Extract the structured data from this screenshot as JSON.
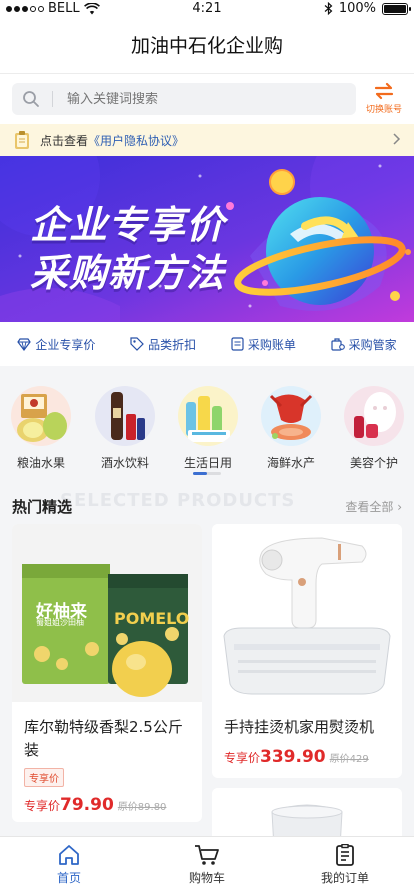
{
  "status_bar": {
    "carrier": "BELL",
    "time": "4:21",
    "battery": "100%",
    "battery_level": 1.0
  },
  "header": {
    "title": "加油中石化企业购"
  },
  "search": {
    "placeholder": "输入关键词搜索",
    "switch_label": "切换账号"
  },
  "notice": {
    "prefix": "点击查看",
    "link": "《用户隐私协议》"
  },
  "banner": {
    "line1": "企业专享价",
    "line2": "采购新方法"
  },
  "features": [
    {
      "label": "企业专享价",
      "icon": "diamond-icon"
    },
    {
      "label": "品类折扣",
      "icon": "tag-icon"
    },
    {
      "label": "采购账单",
      "icon": "bill-icon"
    },
    {
      "label": "采购管家",
      "icon": "manager-icon"
    }
  ],
  "categories": [
    {
      "label": "粮油水果",
      "icon": "fruit-icon"
    },
    {
      "label": "酒水饮料",
      "icon": "drinks-icon"
    },
    {
      "label": "生活日用",
      "icon": "daily-goods-icon"
    },
    {
      "label": "海鲜水产",
      "icon": "seafood-icon"
    },
    {
      "label": "美容个护",
      "icon": "beauty-icon"
    }
  ],
  "hot": {
    "title": "热门精选",
    "bg_text": "SELECTED PRODUCTS",
    "more": "查看全部"
  },
  "products": [
    {
      "name": "库尔勒特级香梨2.5公斤装",
      "tag": "专享价",
      "price_label": "专享价",
      "price": "79.90",
      "original": "原价89.80",
      "box_brand": "好柚来",
      "box_sub": "蜀姐姐沙田柚",
      "box2_brand": "POMELO"
    },
    {
      "name": "手持挂烫机家用熨烫机",
      "price_label": "专享价",
      "price": "339.90",
      "original": "原价429"
    }
  ],
  "tabbar": [
    {
      "label": "首页",
      "icon": "home-icon",
      "active": true
    },
    {
      "label": "购物车",
      "icon": "cart-icon",
      "active": false
    },
    {
      "label": "我的订单",
      "icon": "orders-icon",
      "active": false
    }
  ],
  "colors": {
    "accent": "#2f67c7",
    "price": "#e02a2a",
    "switch": "#f26b1d",
    "banner_start": "#3a3bd6",
    "banner_end": "#b83be0"
  }
}
